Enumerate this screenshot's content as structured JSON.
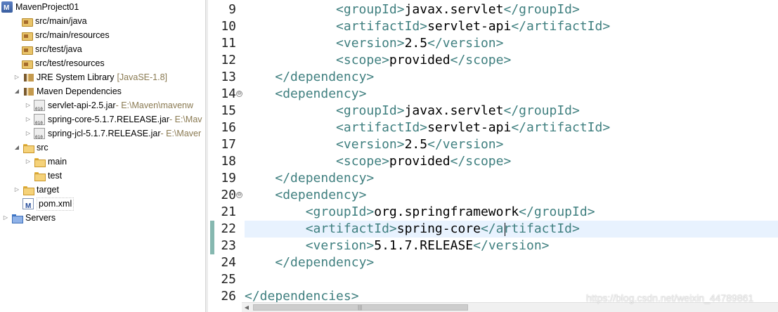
{
  "explorer": {
    "items": [
      {
        "label": "MavenProject01",
        "decoration": "",
        "icon": "maven-project-icon",
        "expanded": true
      },
      {
        "label": "src/main/java",
        "decoration": "",
        "icon": "source-folder-icon"
      },
      {
        "label": "src/main/resources",
        "decoration": "",
        "icon": "source-folder-icon"
      },
      {
        "label": "src/test/java",
        "decoration": "",
        "icon": "source-folder-icon"
      },
      {
        "label": "src/test/resources",
        "decoration": "",
        "icon": "source-folder-icon"
      },
      {
        "label": "JRE System Library",
        "decoration": "[JavaSE-1.8]",
        "icon": "library-icon",
        "expanded": false
      },
      {
        "label": "Maven Dependencies",
        "decoration": "",
        "icon": "library-icon",
        "expanded": true
      },
      {
        "label": "servlet-api-2.5.jar",
        "decoration": " - E:\\Maven\\mavenw",
        "icon": "jar-icon",
        "expanded": false
      },
      {
        "label": "spring-core-5.1.7.RELEASE.jar",
        "decoration": " - E:\\Mav",
        "icon": "jar-icon",
        "expanded": false
      },
      {
        "label": "spring-jcl-5.1.7.RELEASE.jar",
        "decoration": " - E:\\Maver",
        "icon": "jar-icon",
        "expanded": false
      },
      {
        "label": "src",
        "decoration": "",
        "icon": "folder-icon",
        "expanded": true
      },
      {
        "label": "main",
        "decoration": "",
        "icon": "folder-icon",
        "expanded": false
      },
      {
        "label": "test",
        "decoration": "",
        "icon": "folder-icon"
      },
      {
        "label": "target",
        "decoration": "",
        "icon": "folder-icon",
        "expanded": false
      },
      {
        "label": "pom.xml",
        "decoration": "",
        "icon": "maven-pom-icon",
        "selected": true
      },
      {
        "label": "Servers",
        "decoration": "",
        "icon": "servers-folder-icon",
        "expanded": false
      }
    ]
  },
  "editor": {
    "current_line": "22",
    "lines": [
      {
        "num": "9",
        "indent": "            ",
        "open": "<groupId>",
        "text": "javax.servlet",
        "close": "</groupId>"
      },
      {
        "num": "10",
        "indent": "            ",
        "open": "<artifactId>",
        "text": "servlet-api",
        "close": "</artifactId>"
      },
      {
        "num": "11",
        "indent": "            ",
        "open": "<version>",
        "text": "2.5",
        "close": "</version>"
      },
      {
        "num": "12",
        "indent": "            ",
        "open": "<scope>",
        "text": "provided",
        "close": "</scope>"
      },
      {
        "num": "13",
        "indent": "    ",
        "open": "</dependency>",
        "text": "",
        "close": ""
      },
      {
        "num": "14",
        "indent": "    ",
        "open": "<dependency>",
        "text": "",
        "close": "",
        "fold": "⊖"
      },
      {
        "num": "15",
        "indent": "            ",
        "open": "<groupId>",
        "text": "javax.servlet",
        "close": "</groupId>"
      },
      {
        "num": "16",
        "indent": "            ",
        "open": "<artifactId>",
        "text": "servlet-api",
        "close": "</artifactId>"
      },
      {
        "num": "17",
        "indent": "            ",
        "open": "<version>",
        "text": "2.5",
        "close": "</version>"
      },
      {
        "num": "18",
        "indent": "            ",
        "open": "<scope>",
        "text": "provided",
        "close": "</scope>"
      },
      {
        "num": "19",
        "indent": "    ",
        "open": "</dependency>",
        "text": "",
        "close": ""
      },
      {
        "num": "20",
        "indent": "    ",
        "open": "<dependency>",
        "text": "",
        "close": "",
        "fold": "⊖"
      },
      {
        "num": "21",
        "indent": "        ",
        "open": "<groupId>",
        "text": "org.springframework",
        "close": "</groupId>"
      },
      {
        "num": "22",
        "indent": "        ",
        "open": "<artifactId>",
        "text": "spring-core",
        "close": "</artifactId>"
      },
      {
        "num": "23",
        "indent": "        ",
        "open": "<version>",
        "text": "5.1.7.RELEASE",
        "close": "</version>"
      },
      {
        "num": "24",
        "indent": "    ",
        "open": "</dependency>",
        "text": "",
        "close": ""
      },
      {
        "num": "25",
        "indent": "",
        "open": "",
        "text": "",
        "close": ""
      },
      {
        "num": "26",
        "indent": "",
        "open": "</dependencies>",
        "text": "",
        "close": ""
      }
    ]
  },
  "scrollbar": {
    "left_arrow": "◀",
    "grip": "|||"
  },
  "watermark": "https://blog.csdn.net/weixin_44789861",
  "colors": {
    "tag": "#3f7f7f",
    "current_line_bg": "#e8f2fe",
    "change_ruler": "#86b8b0"
  }
}
